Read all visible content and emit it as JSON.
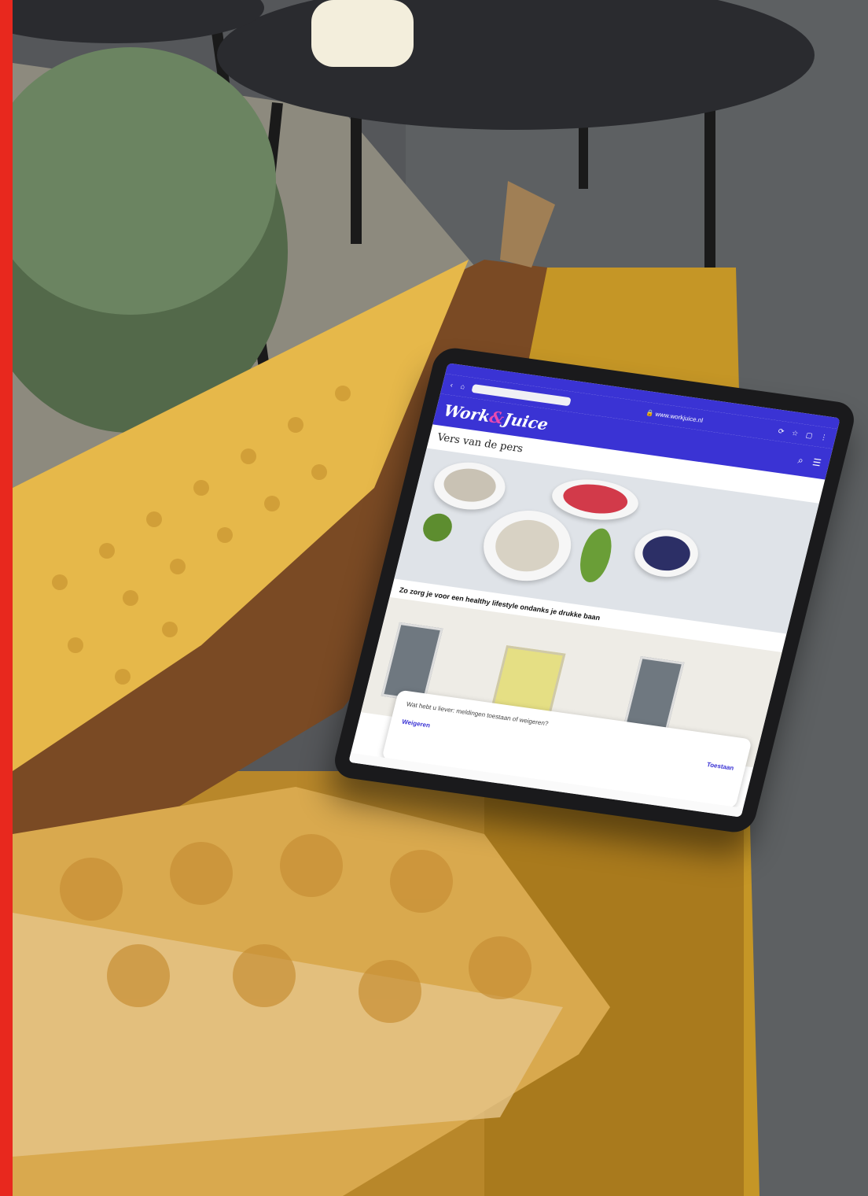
{
  "site": {
    "logo_text_1": "Work",
    "logo_amp": "&",
    "logo_text_2": "Juice",
    "url": "www.workjuice.nl"
  },
  "colors": {
    "accent_stripe": "#e8281e",
    "site_brand": "#3a33d4",
    "logo_accent": "#e94ab0"
  },
  "browser": {
    "back_icon": "back-arrow-icon",
    "home_icon": "home-icon",
    "lock_icon": "lock-icon"
  },
  "header_icons": [
    "reload-icon",
    "home-icon",
    "star-icon",
    "tabs-icon",
    "menu-icon"
  ],
  "page": {
    "section_title": "Vers van de pers",
    "article_title": "Zo zorg je voor een healthy lifestyle ondanks je drukke baan"
  },
  "content_icons": [
    "search-icon",
    "hamburger-icon"
  ],
  "cookie_banner": {
    "message": "Wat hebt u liever: meldingen toestaan of weigeren?",
    "decline_label": "Weigeren",
    "allow_label": "Toestaan"
  }
}
